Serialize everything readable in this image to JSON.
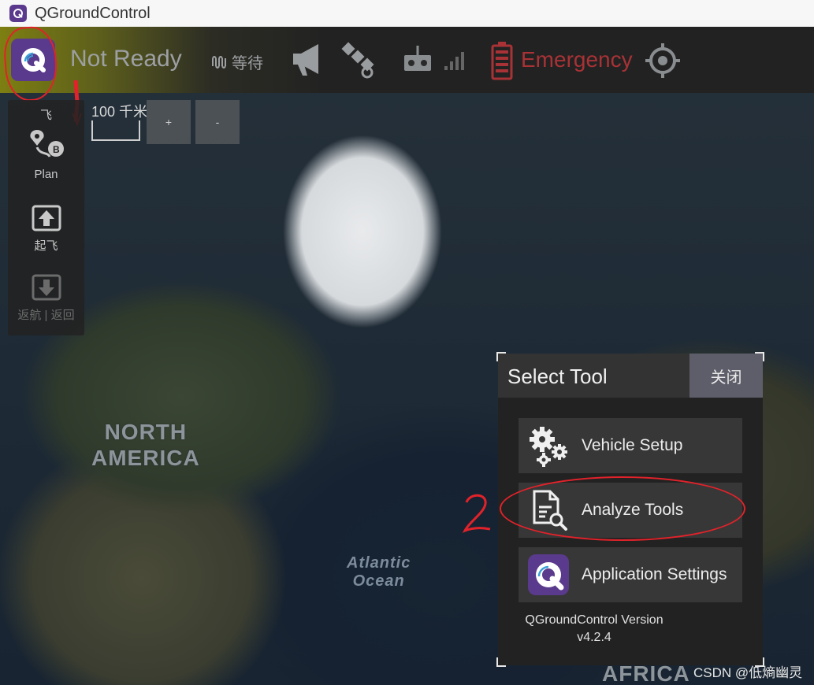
{
  "window": {
    "title": "QGroundControl"
  },
  "toolbar": {
    "status": "Not Ready",
    "wait_label": "等待",
    "emergency_label": "Emergency"
  },
  "map": {
    "scale_label": "100 千米",
    "zoom_in": "+",
    "zoom_out": "-",
    "labels": {
      "north_america_1": "NORTH",
      "north_america_2": "AMERICA",
      "ocean_1": "Atlantic",
      "ocean_2": "Ocean",
      "africa": "AFRICA"
    }
  },
  "toolstrip": {
    "items": [
      {
        "label": "飞"
      },
      {
        "label": "Plan"
      },
      {
        "label": "起飞"
      },
      {
        "label": "返航 | 返回"
      }
    ]
  },
  "dialog": {
    "title": "Select Tool",
    "close_label": "关闭",
    "tools": [
      {
        "label": "Vehicle Setup"
      },
      {
        "label": "Analyze Tools"
      },
      {
        "label": "Application Settings"
      }
    ],
    "version_title": "QGroundControl Version",
    "version_number": "v4.2.4"
  },
  "annotations": {
    "step_two": "2"
  },
  "watermark": "CSDN @低熵幽灵",
  "colors": {
    "accent": "#5a3a8c",
    "emergency": "#a83236",
    "annotation": "#e2222a"
  },
  "icons": [
    "qgc-logo-icon",
    "wave-icon",
    "megaphone-icon",
    "satellite-icon",
    "rc-icon",
    "signal-icon",
    "battery-icon",
    "crosshair-icon",
    "plan-icon",
    "takeoff-icon",
    "return-icon",
    "gears-icon",
    "analyze-icon"
  ]
}
